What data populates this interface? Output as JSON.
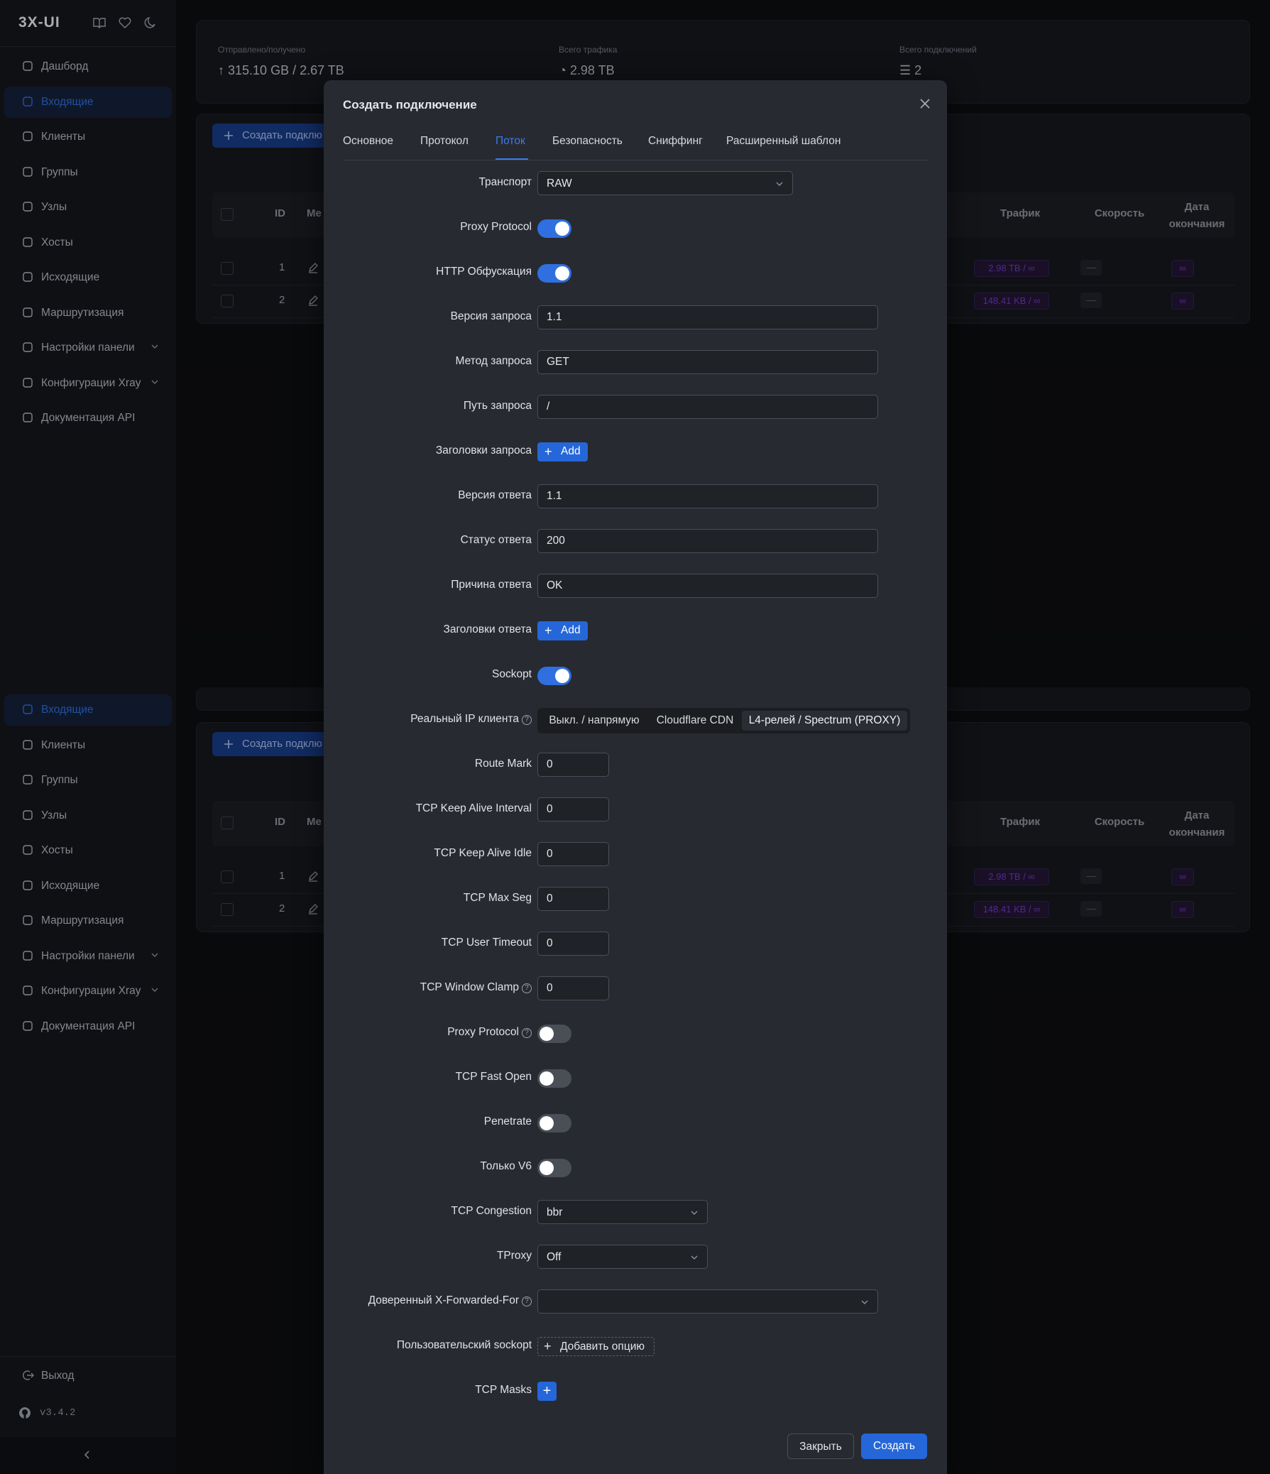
{
  "app": {
    "logo": "3X-UI",
    "version": "v3.4.2"
  },
  "sidebar": {
    "items": [
      {
        "label": "Дашборд",
        "icon": "dashboard-icon"
      },
      {
        "label": "Входящие",
        "icon": "inbound-icon",
        "active": true
      },
      {
        "label": "Клиенты",
        "icon": "users-icon"
      },
      {
        "label": "Группы",
        "icon": "tag-icon"
      },
      {
        "label": "Узлы",
        "icon": "nodes-icon"
      },
      {
        "label": "Хосты",
        "icon": "globe-icon"
      },
      {
        "label": "Исходящие",
        "icon": "outbound-icon"
      },
      {
        "label": "Маршрутизация",
        "icon": "routing-icon"
      },
      {
        "label": "Настройки панели",
        "icon": "settings-icon",
        "expandable": true
      },
      {
        "label": "Конфигурации Xray",
        "icon": "tool-icon",
        "expandable": true
      },
      {
        "label": "Документация API",
        "icon": "api-icon"
      }
    ],
    "items2": [
      {
        "label": "Входящие",
        "icon": "inbound-icon",
        "active": true
      },
      {
        "label": "Клиенты",
        "icon": "users-icon"
      },
      {
        "label": "Группы",
        "icon": "tag-icon"
      },
      {
        "label": "Узлы",
        "icon": "nodes-icon"
      },
      {
        "label": "Хосты",
        "icon": "globe-icon"
      },
      {
        "label": "Исходящие",
        "icon": "outbound-icon"
      },
      {
        "label": "Маршрутизация",
        "icon": "routing-icon"
      },
      {
        "label": "Настройки панели",
        "icon": "settings-icon",
        "expandable": true
      },
      {
        "label": "Конфигурации Xray",
        "icon": "tool-icon",
        "expandable": true
      },
      {
        "label": "Документация API",
        "icon": "api-icon"
      }
    ],
    "logout": "Выход"
  },
  "stats": {
    "sent_received_label": "Отправлено/получено",
    "sent_received_value": "315.10 GB / 2.67 TB",
    "total_traffic_label": "Всего трафика",
    "total_traffic_value": "2.98 TB",
    "total_connections_label": "Всего подключений",
    "total_connections_value": "2"
  },
  "inbounds": {
    "create_label": "Создать подклю",
    "columns": {
      "id": "ID",
      "me": "Ме",
      "traffic": "Трафик",
      "speed": "Скорость",
      "expiry": "Дата окончания"
    },
    "rows": [
      {
        "id": "1",
        "traffic": "2.98 TB / ∞",
        "speed": "—",
        "expiry": "∞"
      },
      {
        "id": "2",
        "traffic": "148.41 KB / ∞",
        "speed": "—",
        "expiry": "∞"
      }
    ]
  },
  "modal": {
    "title": "Создать подключение",
    "tabs": [
      "Основное",
      "Протокол",
      "Поток",
      "Безопасность",
      "Сниффинг",
      "Расширенный шаблон"
    ],
    "active_tab": "Поток",
    "fields": {
      "transport": {
        "label": "Транспорт",
        "value": "RAW"
      },
      "proxy_protocol": {
        "label": "Proxy Protocol",
        "on": true
      },
      "http_obfuscation": {
        "label": "HTTP Обфускация",
        "on": true
      },
      "request_version": {
        "label": "Версия запроса",
        "value": "1.1"
      },
      "request_method": {
        "label": "Метод запроса",
        "value": "GET"
      },
      "request_path": {
        "label": "Путь запроса",
        "value": "/"
      },
      "request_headers": {
        "label": "Заголовки запроса",
        "button": "Add"
      },
      "response_version": {
        "label": "Версия ответа",
        "value": "1.1"
      },
      "response_status": {
        "label": "Статус ответа",
        "value": "200"
      },
      "response_reason": {
        "label": "Причина ответа",
        "value": "OK"
      },
      "response_headers": {
        "label": "Заголовки ответа",
        "button": "Add"
      },
      "sockopt": {
        "label": "Sockopt",
        "on": true
      },
      "real_client_ip": {
        "label": "Реальный IP клиента",
        "options": [
          "Выкл. / напрямую",
          "Cloudflare CDN",
          "L4-релей / Spectrum (PROXY)"
        ],
        "selected": "L4-релей / Spectrum (PROXY)"
      },
      "route_mark": {
        "label": "Route Mark",
        "value": "0"
      },
      "tcp_keepalive_interval": {
        "label": "TCP Keep Alive Interval",
        "value": "0"
      },
      "tcp_keepalive_idle": {
        "label": "TCP Keep Alive Idle",
        "value": "0"
      },
      "tcp_max_seg": {
        "label": "TCP Max Seg",
        "value": "0"
      },
      "tcp_user_timeout": {
        "label": "TCP User Timeout",
        "value": "0"
      },
      "tcp_window_clamp": {
        "label": "TCP Window Clamp",
        "value": "0"
      },
      "sockopt_proxy_protocol": {
        "label": "Proxy Protocol",
        "on": false
      },
      "tcp_fast_open": {
        "label": "TCP Fast Open",
        "on": false
      },
      "penetrate": {
        "label": "Penetrate",
        "on": false
      },
      "v6_only": {
        "label": "Только V6",
        "on": false
      },
      "tcp_congestion": {
        "label": "TCP Congestion",
        "value": "bbr"
      },
      "tproxy": {
        "label": "TProxy",
        "value": "Off"
      },
      "trusted_xff": {
        "label": "Доверенный X-Forwarded-For",
        "value": ""
      },
      "custom_sockopt": {
        "label": "Пользовательский sockopt",
        "button": "Добавить опцию"
      },
      "tcp_masks": {
        "label": "TCP Masks"
      }
    },
    "footer": {
      "close": "Закрыть",
      "create": "Создать"
    }
  },
  "colors": {
    "accent": "#2567d9",
    "background": "#0d0e11",
    "modal": "#272a31",
    "purple_tag": "#6b39b8"
  }
}
